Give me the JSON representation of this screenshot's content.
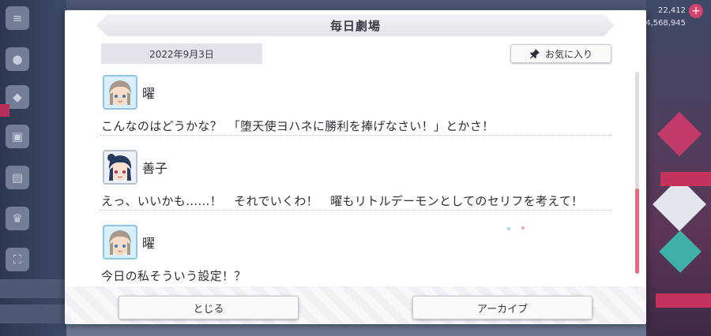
{
  "dialog": {
    "title": "毎日劇場",
    "date": "2022年9月3日",
    "favorite_label": "お気に入り",
    "close_label": "とじる",
    "archive_label": "アーカイブ"
  },
  "messages": [
    {
      "speaker": "曜",
      "avatar": "you-avatar",
      "text": "こんなのはどうかな？　「堕天使ヨハネに勝利を捧げなさい！」とかさ！"
    },
    {
      "speaker": "善子",
      "avatar": "yoshiko-avatar",
      "text": "えっ、いいかも……！　それでいくわ！　曜もリトルデーモンとしてのセリフを考えて！"
    },
    {
      "speaker": "曜",
      "avatar": "you-avatar",
      "text": "今日の私そういう設定！？"
    }
  ],
  "background": {
    "top_right_count": "22,412",
    "top_right_sub": "4,568,945"
  },
  "colors": {
    "accent": "#e8697d",
    "title_bar": "#e8e8ee",
    "date_box": "#e2e3ec"
  }
}
